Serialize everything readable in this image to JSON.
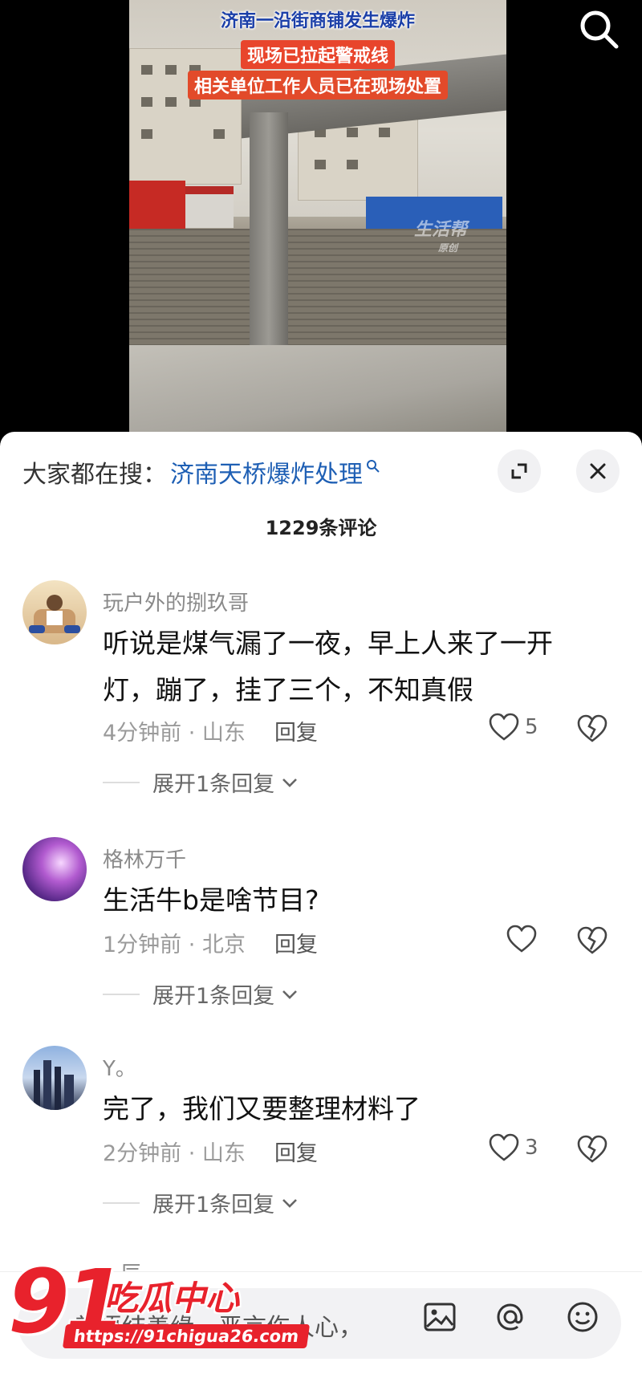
{
  "video": {
    "caption_line1": "济南一沿街商铺发生爆炸",
    "caption_line2": "现场已拉起警戒线",
    "caption_line3": "相关单位工作人员已在现场处置",
    "channel_watermark": "生活帮",
    "channel_watermark_sub": "原创"
  },
  "search_suggest": {
    "label": "大家都在搜：",
    "keyword": "济南天桥爆炸处理"
  },
  "comments_count": "1229条评论",
  "comments": [
    {
      "username": "玩户外的捌玖哥",
      "text": "听说是煤气漏了一夜，早上人来了一开灯，蹦了，挂了三个，不知真假",
      "time_location": "4分钟前 · 山东",
      "reply": "回复",
      "likes": "5",
      "expand": "展开1条回复"
    },
    {
      "username": "格林万千",
      "text": "生活牛b是啥节目?",
      "time_location": "1分钟前 · 北京",
      "reply": "回复",
      "likes": "",
      "expand": "展开1条回复"
    },
    {
      "username": "Y。",
      "text": "完了，我们又要整理材料了",
      "time_location": "2分钟前 · 山东",
      "reply": "回复",
      "likes": "3",
      "expand": "展开1条回复"
    }
  ],
  "partial_comment_username": "辰",
  "input": {
    "placeholder": "善语结善缘，恶言伤人心，"
  },
  "watermark": {
    "number": "91",
    "name": "吃瓜中心",
    "url": "https://91chigua26.com"
  },
  "colors": {
    "link_blue": "#1e5fb4",
    "watermark_red": "#e8222c",
    "caption_blue": "#1b3fa8",
    "caption_red": "#e8452c"
  }
}
